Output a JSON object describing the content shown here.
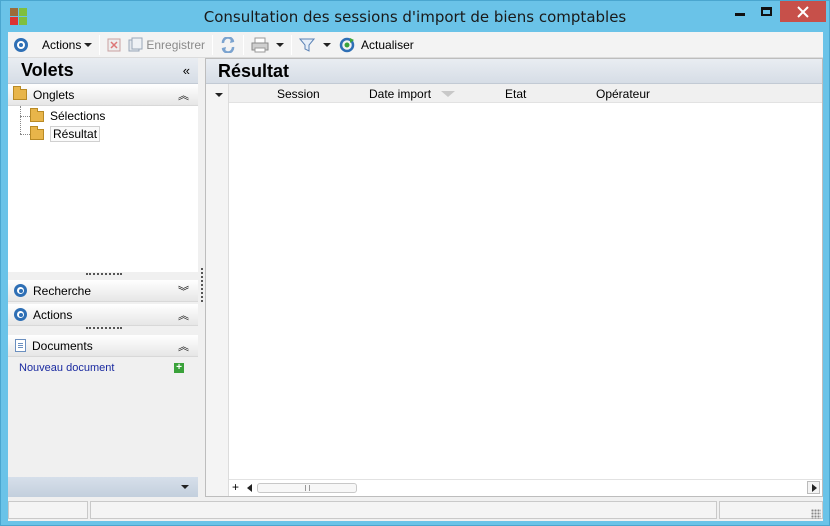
{
  "window": {
    "title": "Consultation des sessions d'import de biens comptables"
  },
  "toolbar": {
    "actions_label": "Actions",
    "save_label": "Enregistrer",
    "refresh_label": "Actualiser"
  },
  "left_panel": {
    "header": "Volets",
    "tabs_group": {
      "title": "Onglets",
      "items": [
        {
          "label": "Sélections",
          "selected": false
        },
        {
          "label": "Résultat",
          "selected": true
        }
      ]
    },
    "search_group": {
      "title": "Recherche"
    },
    "actions_group": {
      "title": "Actions"
    },
    "documents_group": {
      "title": "Documents",
      "new_document_label": "Nouveau document"
    }
  },
  "result_panel": {
    "header": "Résultat",
    "columns": [
      "Session",
      "Date import",
      "Etat",
      "Opérateur"
    ],
    "rows": []
  },
  "colors": {
    "window_frame": "#6ac3e8",
    "accent_blue": "#2e6fb5",
    "close_button": "#c7504a",
    "link": "#1a2aa0"
  },
  "icons": {
    "app": "app-icon",
    "actions": "ring-icon",
    "delete": "delete-icon",
    "save": "save-icon",
    "sync": "sync-icon",
    "print": "print-icon",
    "filter": "filter-icon",
    "refresh": "refresh-icon",
    "folder": "folder-icon",
    "document": "document-icon",
    "add": "plus-icon"
  }
}
